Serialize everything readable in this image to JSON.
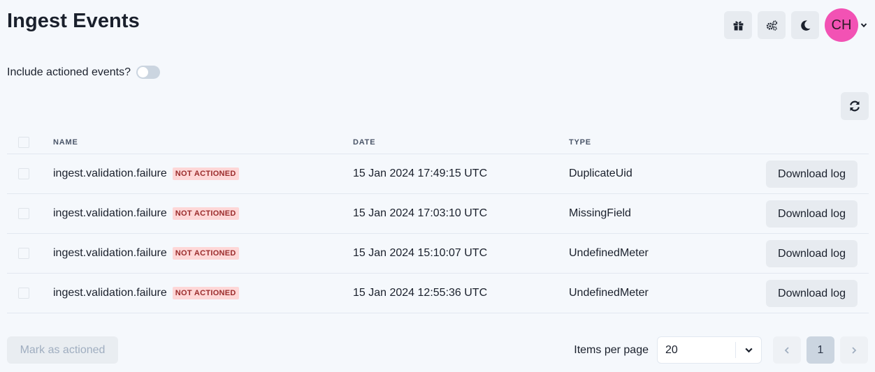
{
  "page": {
    "title": "Ingest Events"
  },
  "header": {
    "avatar_initials": "CH",
    "icons": [
      "gift-icon",
      "cogs-icon",
      "moon-icon",
      "chevron-down-icon"
    ]
  },
  "filters": {
    "include_actioned_label": "Include actioned events?",
    "include_actioned_value": false
  },
  "table": {
    "columns": [
      "NAME",
      "DATE",
      "TYPE"
    ],
    "rows": [
      {
        "name": "ingest.validation.failure",
        "status": "NOT ACTIONED",
        "date": "15 Jan 2024 17:49:15 UTC",
        "type": "DuplicateUid",
        "action": "Download log"
      },
      {
        "name": "ingest.validation.failure",
        "status": "NOT ACTIONED",
        "date": "15 Jan 2024 17:03:10 UTC",
        "type": "MissingField",
        "action": "Download log"
      },
      {
        "name": "ingest.validation.failure",
        "status": "NOT ACTIONED",
        "date": "15 Jan 2024 15:10:07 UTC",
        "type": "UndefinedMeter",
        "action": "Download log"
      },
      {
        "name": "ingest.validation.failure",
        "status": "NOT ACTIONED",
        "date": "15 Jan 2024 12:55:36 UTC",
        "type": "UndefinedMeter",
        "action": "Download log"
      }
    ]
  },
  "footer": {
    "mark_actioned_label": "Mark as actioned",
    "items_per_page_label": "Items per page",
    "items_per_page_value": "20",
    "current_page": "1"
  },
  "colors": {
    "background": "#f5f8fc",
    "avatar": "#f252b4",
    "badge_bg": "#fed7d7",
    "badge_text": "#9b2c2c"
  }
}
